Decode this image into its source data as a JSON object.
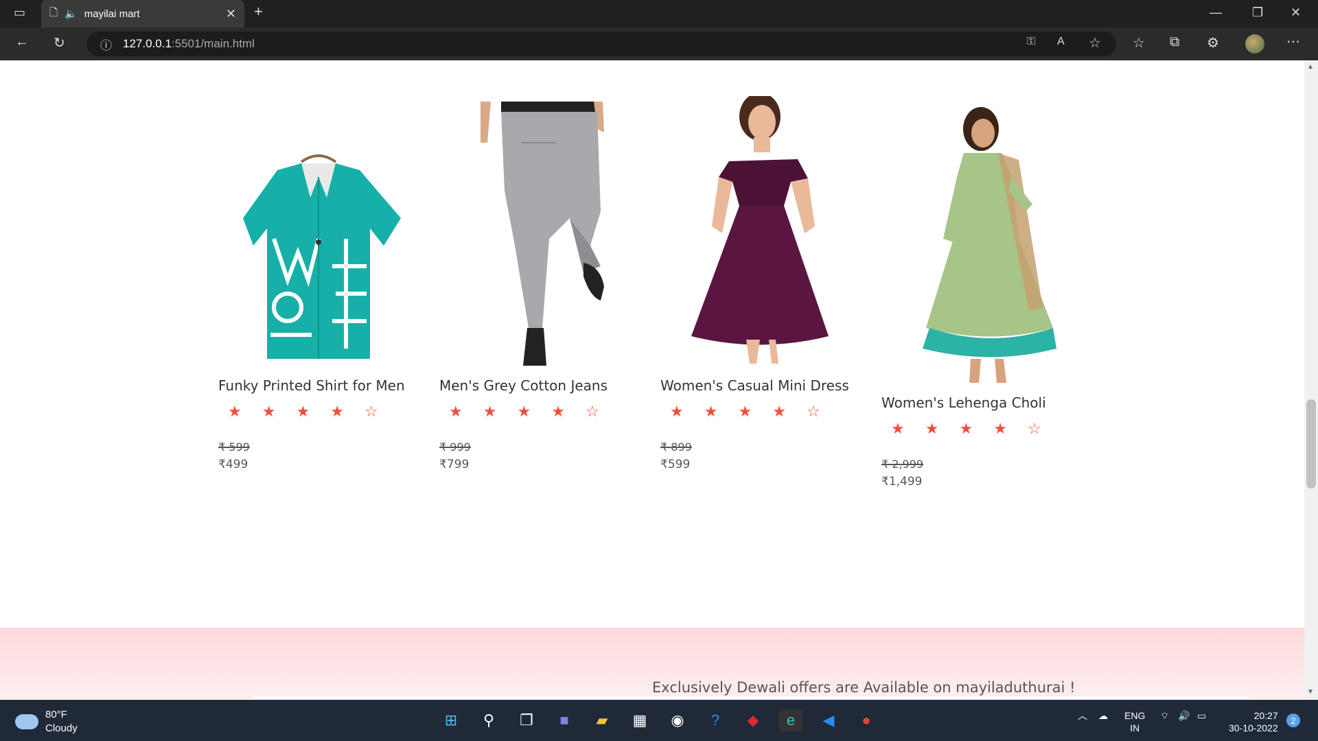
{
  "browser": {
    "tab_title": "mayilai mart",
    "url_host": "127.0.0.1",
    "url_rest": ":5501/main.html"
  },
  "products": [
    {
      "name": "Funky Printed Shirt for Men",
      "rating": 4,
      "old_price": "₹ 599",
      "price": "₹499",
      "image": "shirt"
    },
    {
      "name": "Men's Grey Cotton Jeans",
      "rating": 4,
      "old_price": "₹ 999",
      "price": "₹799",
      "image": "jeans"
    },
    {
      "name": "Women's Casual Mini Dress",
      "rating": 4,
      "old_price": "₹ 899",
      "price": "₹599",
      "image": "dress"
    },
    {
      "name": "Women's Lehenga Choli",
      "rating": 4,
      "old_price": "₹ 2,999",
      "price": "₹1,499",
      "image": "lehenga"
    }
  ],
  "banner": {
    "text": "Exclusively Dewali offers are Available on mayiladuthurai !"
  },
  "taskbar": {
    "temp": "80°F",
    "condition": "Cloudy",
    "lang1": "ENG",
    "lang2": "IN",
    "time": "20:27",
    "date": "30-10-2022",
    "notifications": "2"
  },
  "colors": {
    "star": "#f14f3c",
    "banner": "#fdd9dc"
  }
}
